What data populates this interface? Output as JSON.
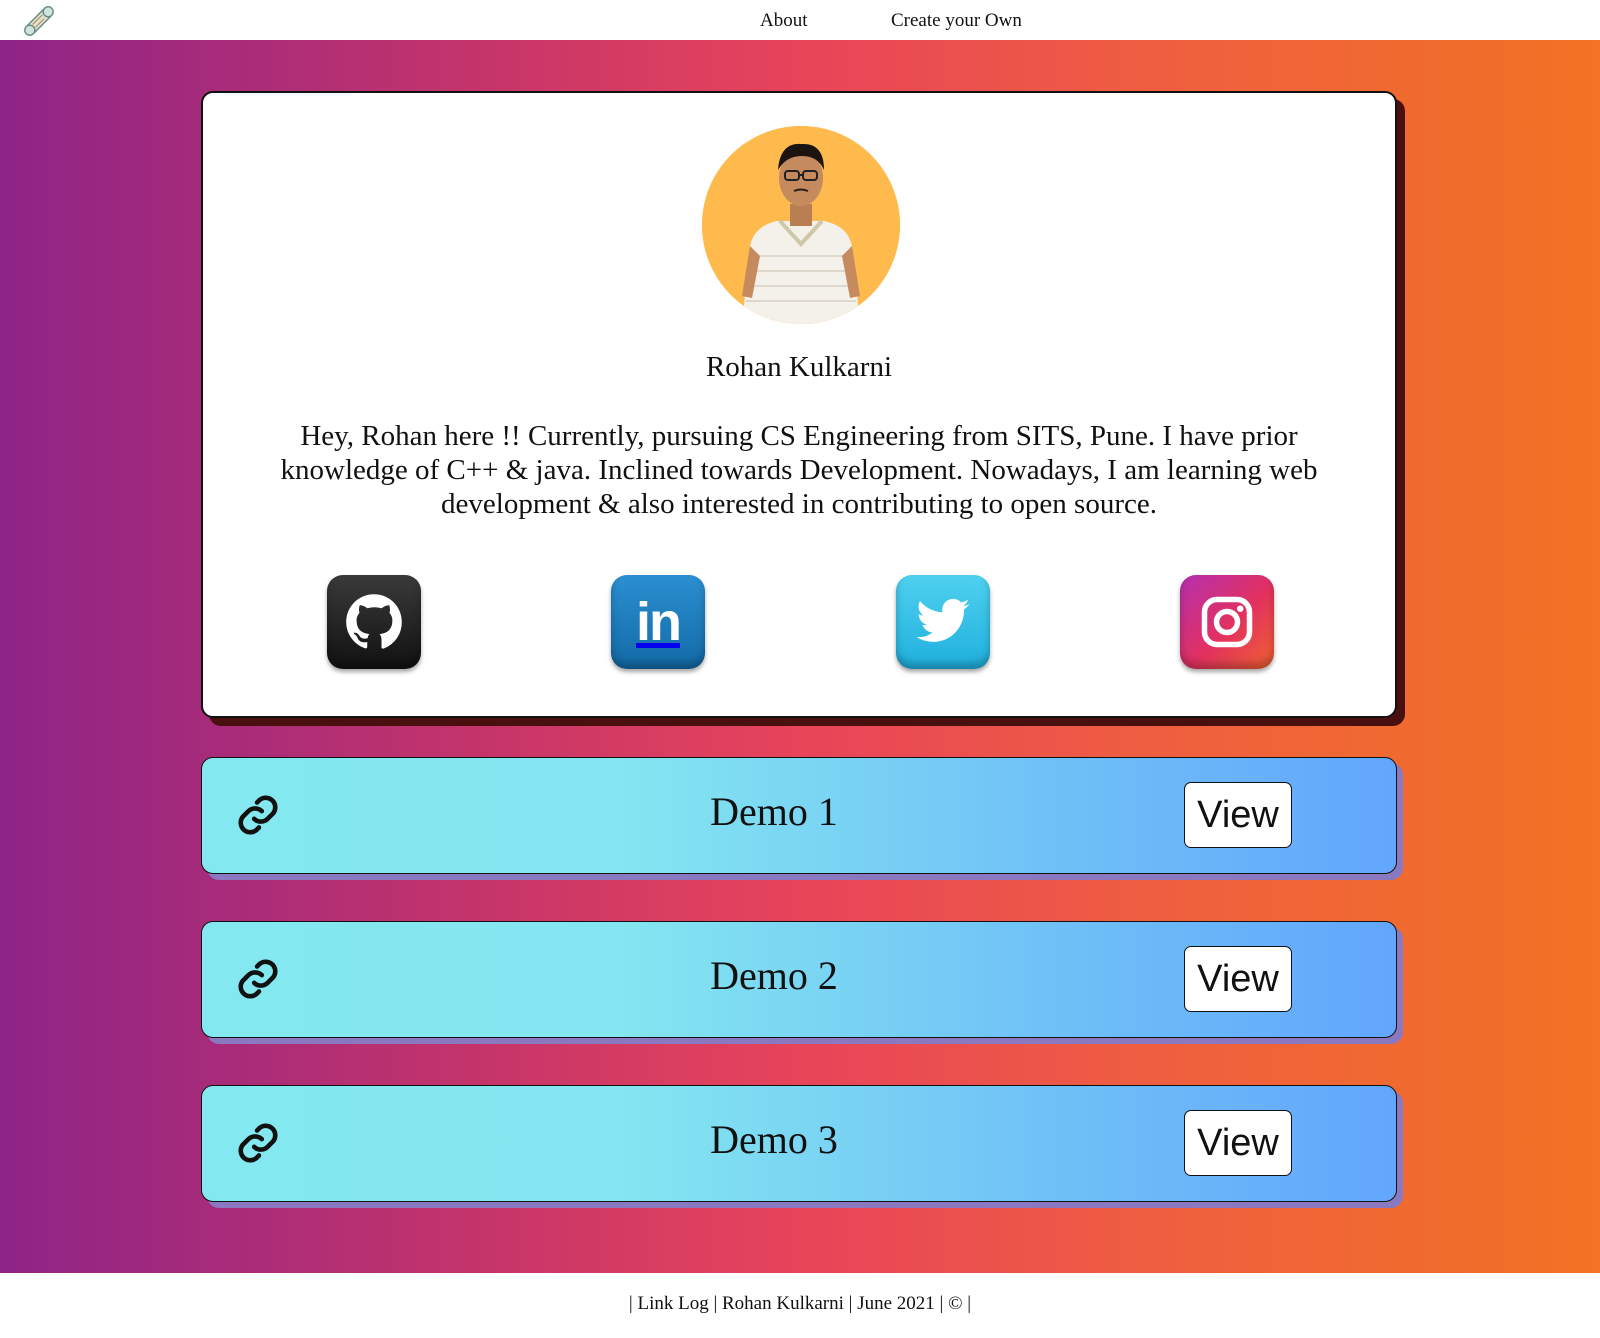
{
  "nav": {
    "logo_icon": "scroll-logo-icon",
    "about_label": "About",
    "create_label": "Create your Own"
  },
  "profile": {
    "name": "Rohan Kulkarni",
    "bio": "Hey, Rohan here !! Currently, pursuing CS Engineering from SITS, Pune. I have prior knowledge of C++ & java. Inclined towards Development. Nowadays, I am learning web development & also interested in contributing to open source.",
    "avatar_bg": "#ffba4d",
    "socials": [
      {
        "icon": "github-icon"
      },
      {
        "icon": "linkedin-icon",
        "text": "in"
      },
      {
        "icon": "twitter-icon"
      },
      {
        "icon": "instagram-icon"
      }
    ]
  },
  "links": [
    {
      "title": "Demo 1",
      "button": "View",
      "icon": "link-chain-icon"
    },
    {
      "title": "Demo 2",
      "button": "View",
      "icon": "link-chain-icon"
    },
    {
      "title": "Demo 3",
      "button": "View",
      "icon": "link-chain-icon"
    }
  ],
  "footer": {
    "text": "| Link Log | Rohan Kulkarni | June 2021 | © |"
  },
  "colors": {
    "gradient_start": "#8e2487",
    "gradient_mid": "#e8445a",
    "gradient_end": "#f17323",
    "card_cyan": "#84e8f0",
    "card_blue": "#62a6fd"
  }
}
